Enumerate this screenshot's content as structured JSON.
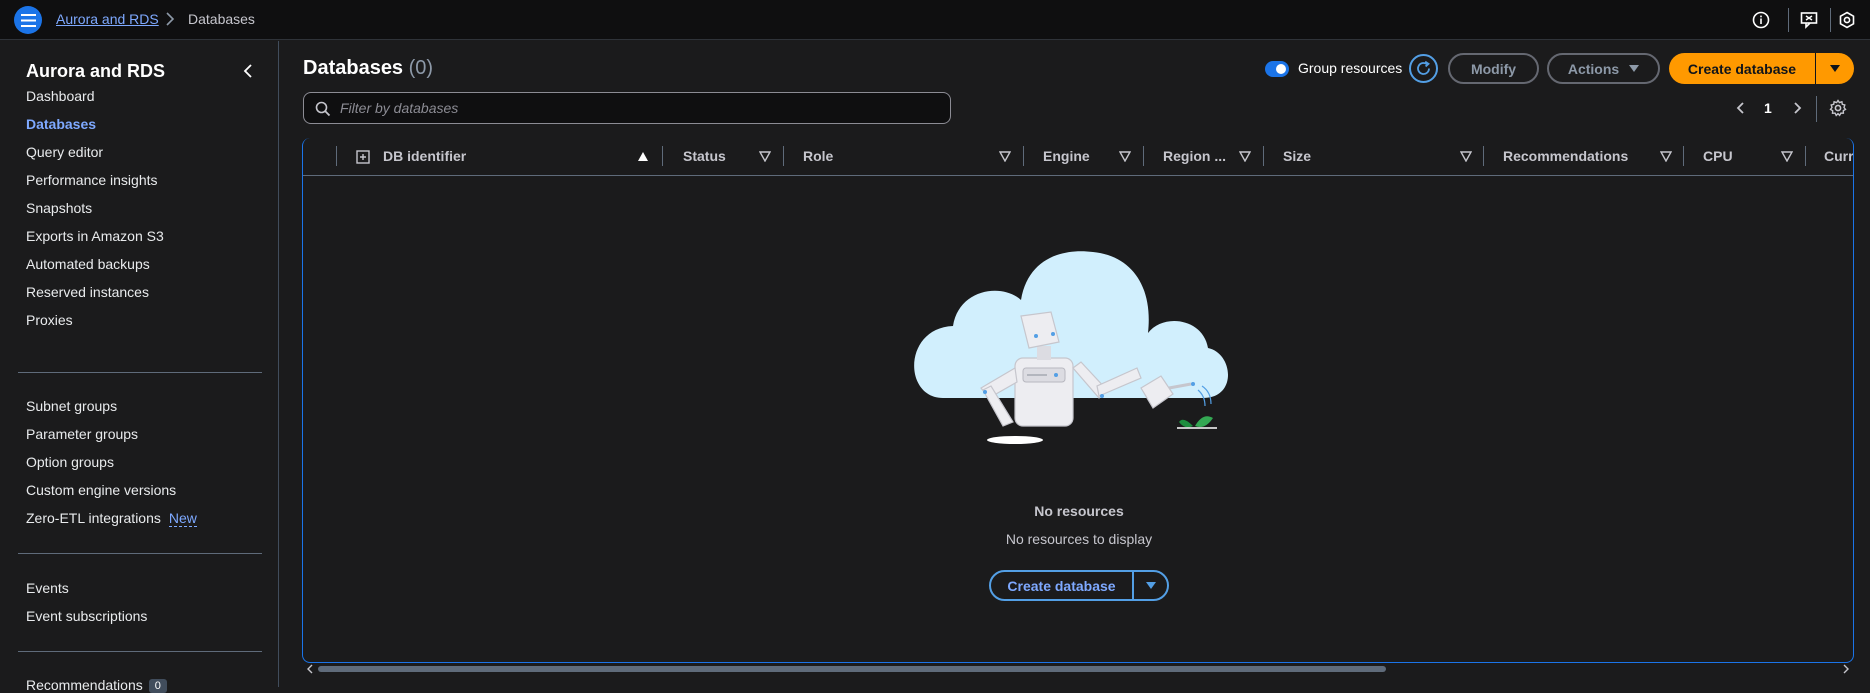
{
  "breadcrumb": {
    "parent": "Aurora and RDS",
    "current": "Databases"
  },
  "sidebar": {
    "title": "Aurora and RDS",
    "group1": [
      "Dashboard",
      "Databases",
      "Query editor",
      "Performance insights",
      "Snapshots",
      "Exports in Amazon S3",
      "Automated backups",
      "Reserved instances",
      "Proxies"
    ],
    "group2": [
      "Subnet groups",
      "Parameter groups",
      "Option groups",
      "Custom engine versions",
      "Zero-ETL integrations"
    ],
    "new_badge": "New",
    "group3": [
      "Events",
      "Event subscriptions"
    ],
    "recommendations_label": "Recommendations",
    "recommendations_count": "0"
  },
  "main": {
    "title": "Databases",
    "count": "(0)",
    "group_resources_label": "Group resources",
    "modify_label": "Modify",
    "actions_label": "Actions",
    "create_label": "Create database",
    "filter_placeholder": "Filter by databases",
    "page_number": "1"
  },
  "table": {
    "columns": [
      "DB identifier",
      "Status",
      "Role",
      "Engine",
      "Region ...",
      "Size",
      "Recommendations",
      "CPU",
      "Curr"
    ]
  },
  "empty": {
    "title": "No resources",
    "subtitle": "No resources to display",
    "button_label": "Create database"
  },
  "colors": {
    "accent": "#1b74e8",
    "link": "#7ea9ff",
    "primary_button": "#ff9900"
  }
}
